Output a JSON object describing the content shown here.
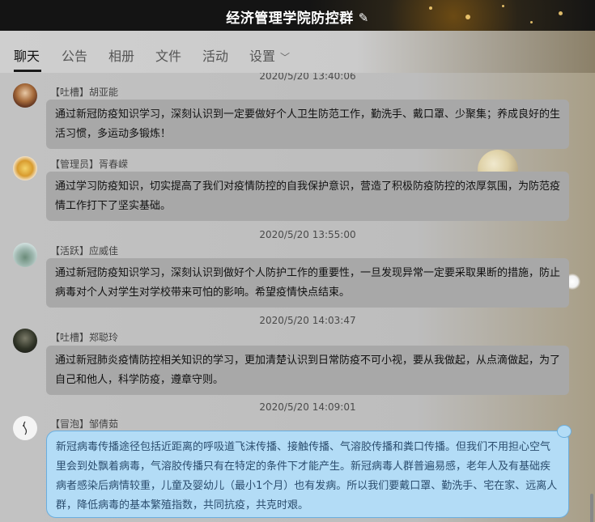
{
  "window": {
    "title": "经济管理学院防控群",
    "edit_icon": "edit-pencil-icon"
  },
  "tabs": [
    {
      "label": "聊天",
      "active": true
    },
    {
      "label": "公告"
    },
    {
      "label": "相册"
    },
    {
      "label": "文件"
    },
    {
      "label": "活动"
    },
    {
      "label": "设置",
      "has_dropdown": true
    }
  ],
  "messages": [
    {
      "timestamp": "2020/5/20 13:40:06",
      "sender": "【吐槽】胡亚能",
      "text": "通过新冠防疫知识学习，深刻认识到一定要做好个人卫生防范工作，勤洗手、戴口罩、少聚集；养成良好的生活习惯，多运动多锻炼！",
      "avatar": "portrait-avatar"
    },
    {
      "sender": "【管理员】胥春嵘",
      "text": "通过学习防疫知识，切实提高了我们对疫情防控的自我保护意识，营造了积极防疫防控的浓厚氛围，为防范疫情工作打下了坚实基础。",
      "avatar": "flower-avatar"
    },
    {
      "timestamp": "2020/5/20 13:55:00",
      "sender": "【活跃】应威佳",
      "text": "通过新冠防疫知识学习，深刻认识到做好个人防护工作的重要性，一旦发现异常一定要采取果断的措施，防止病毒对个人对学生对学校带来可怕的影响。希望疫情快点结束。",
      "avatar": "landscape-avatar"
    },
    {
      "timestamp": "2020/5/20 14:03:47",
      "sender": "【吐槽】郑聪玲",
      "text": "通过新冠肺炎疫情防控相关知识的学习，更加清楚认识到日常防疫不可小视，要从我做起，从点滴做起，为了自己和他人，科学防疫，遵章守则。",
      "avatar": "forest-avatar"
    },
    {
      "timestamp": "2020/5/20 14:09:01",
      "sender": "【冒泡】邹倩茹",
      "text": "新冠病毒传播途径包括近距离的呼吸道飞沫传播、接触传播、气溶胶传播和粪口传播。但我们不用担心空气里会到处飘着病毒，气溶胶传播只有在特定的条件下才能产生。新冠病毒人群普遍易感，老年人及有基础疾病者感染后病情较重，儿童及婴幼儿（最小1个月）也有发病。所以我们要戴口罩、勤洗手、宅在家、远离人群，降低病毒的基本繁殖指数，共同抗疫，共克时艰。",
      "avatar": "sketch-avatar",
      "style": "blue"
    }
  ],
  "colors": {
    "bubble": "#a8a8a8",
    "bubble_blue": "#b3dcf6",
    "bubble_blue_border": "#6aaede"
  }
}
